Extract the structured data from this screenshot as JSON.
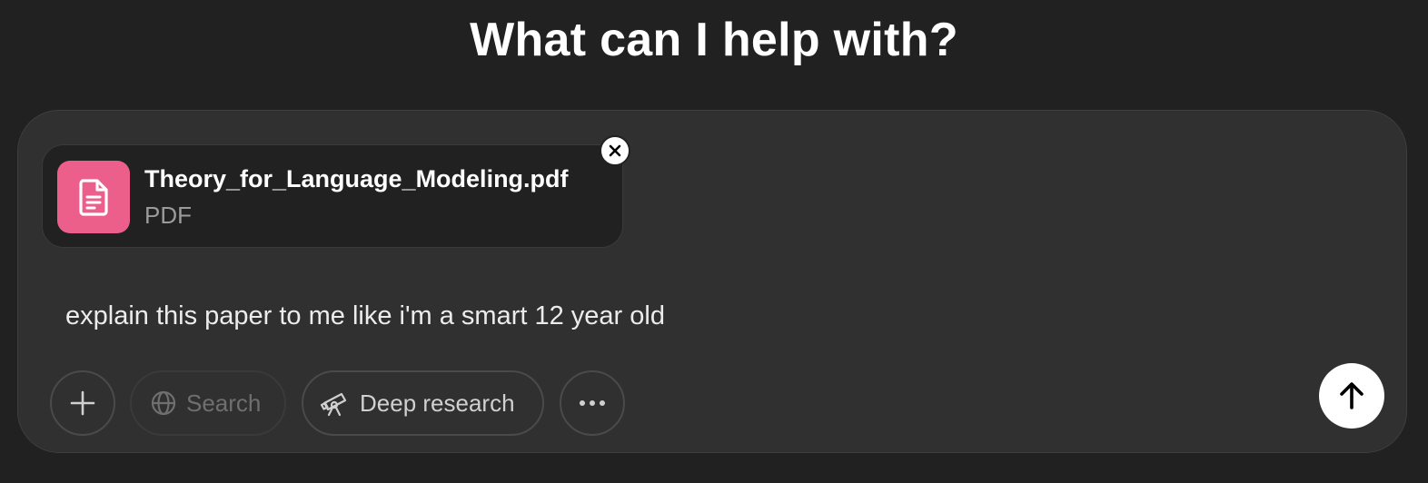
{
  "header": {
    "title": "What can I help with?"
  },
  "composer": {
    "attachment": {
      "file_name": "Theory_for_Language_Modeling.pdf",
      "file_type": "PDF",
      "icon": "document-icon",
      "icon_color": "#ec5f8a",
      "remove_icon": "close-icon"
    },
    "prompt": "explain this paper to me like i'm a smart 12 year old",
    "toolbar": {
      "add_icon": "plus-icon",
      "search_label": "Search",
      "search_icon": "globe-icon",
      "search_state": "disabled",
      "deep_research_label": "Deep research",
      "deep_research_icon": "telescope-icon",
      "more_icon": "ellipsis-icon"
    },
    "send_icon": "arrow-up-icon"
  },
  "colors": {
    "background": "#212121",
    "composer": "#303030",
    "accent_file": "#ec5f8a",
    "send_button": "#ffffff"
  }
}
